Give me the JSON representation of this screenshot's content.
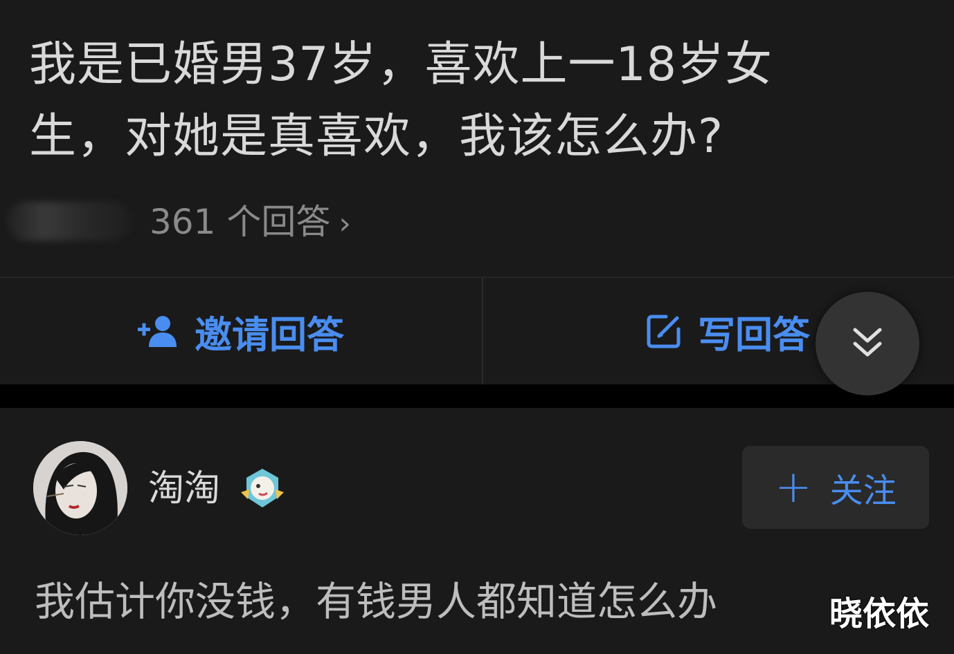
{
  "question": {
    "title": "我是已婚男37岁，喜欢上一18岁女生，对她是真喜欢，我该怎么办?",
    "answer_count": "361 个回答",
    "chevron_icon": "chevron-right-icon"
  },
  "actions": {
    "invite_label": "邀请回答",
    "invite_icon": "add-user-icon",
    "write_label": "写回答",
    "write_icon": "edit-icon",
    "scroll_icon": "double-chevron-down-icon"
  },
  "answer": {
    "author_name": "淘淘",
    "follow_label": "关注",
    "follow_icon": "plus-icon",
    "text": "我估计你没钱，有钱男人都知道怎么办"
  },
  "watermark": "晓依依",
  "colors": {
    "background": "#1a1a1a",
    "accent_blue": "#4a8df0",
    "text_primary": "#d9d9d9",
    "text_muted": "#8a8a8a"
  }
}
